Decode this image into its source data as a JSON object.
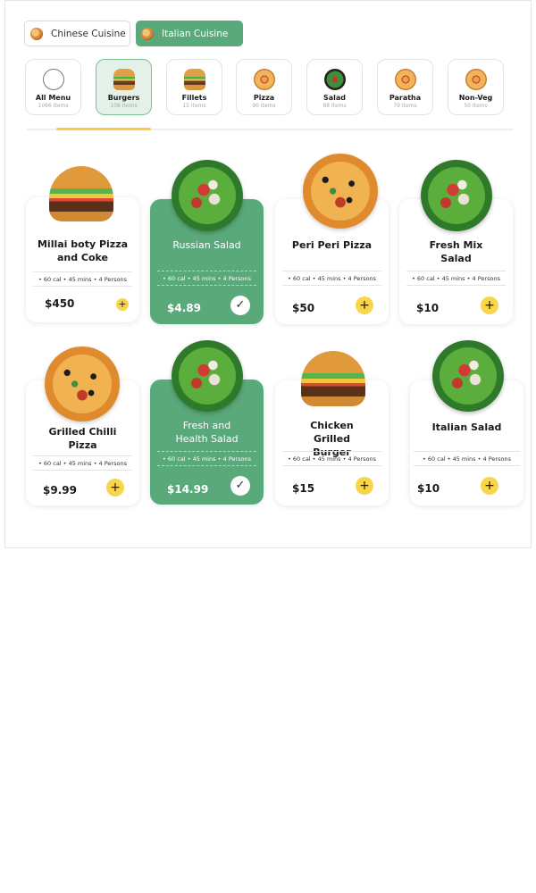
{
  "cuisines": [
    {
      "label": "Chinese Cuisine",
      "active": false
    },
    {
      "label": "Italian Cuisine",
      "active": true
    }
  ],
  "categories": [
    {
      "name": "All Menu",
      "count": "1066 Items",
      "icon": "plate-icon"
    },
    {
      "name": "Burgers",
      "count": "108 Items",
      "icon": "burger-icon",
      "selected": true
    },
    {
      "name": "Fillets",
      "count": "15 Items",
      "icon": "burger-icon"
    },
    {
      "name": "Pizza",
      "count": "90 Items",
      "icon": "pizza-icon"
    },
    {
      "name": "Salad",
      "count": "88 Items",
      "icon": "salad-icon"
    },
    {
      "name": "Paratha",
      "count": "79 Items",
      "icon": "pizza-icon"
    },
    {
      "name": "Non-Veg",
      "count": "50 Items",
      "icon": "pizza-icon"
    }
  ],
  "products": [
    {
      "name": "Millai boty Pizza and Coke",
      "meta": "• 60 cal  •  45 mins  •  4 Persons",
      "price": "$450",
      "image": "burger",
      "selected": false
    },
    {
      "name": "Russian Salad",
      "meta": "• 60 cal  •  45 mins  •  4 Persons",
      "price": "$4.89",
      "image": "salad",
      "selected": true
    },
    {
      "name": "Peri Peri Pizza",
      "meta": "• 60 cal  •  45 mins  •  4 Persons",
      "price": "$50",
      "image": "pizza",
      "selected": false
    },
    {
      "name": "Fresh Mix Salad",
      "meta": "• 60 cal  •  45 mins  •  4 Persons",
      "price": "$10",
      "image": "salad",
      "selected": false
    },
    {
      "name": "Grilled Chilli Pizza",
      "meta": "• 60 cal  •  45 mins  •  4 Persons",
      "price": "$9.99",
      "image": "pizza",
      "selected": false
    },
    {
      "name": "Fresh and Health Salad",
      "meta": "• 60 cal  •  45 mins  •  4 Persons",
      "price": "$14.99",
      "image": "salad",
      "selected": true
    },
    {
      "name": "Chicken Grilled Burger",
      "meta": "• 60 cal  •  45 mins  •  4 Persons",
      "price": "$15",
      "image": "burger",
      "selected": false
    },
    {
      "name": "Italian Salad",
      "meta": "• 60 cal  •  45 mins  •  4 Persons",
      "price": "$10",
      "image": "salad",
      "selected": false
    }
  ],
  "colors": {
    "accent_green": "#5aa97b",
    "accent_yellow": "#f8d54a"
  }
}
